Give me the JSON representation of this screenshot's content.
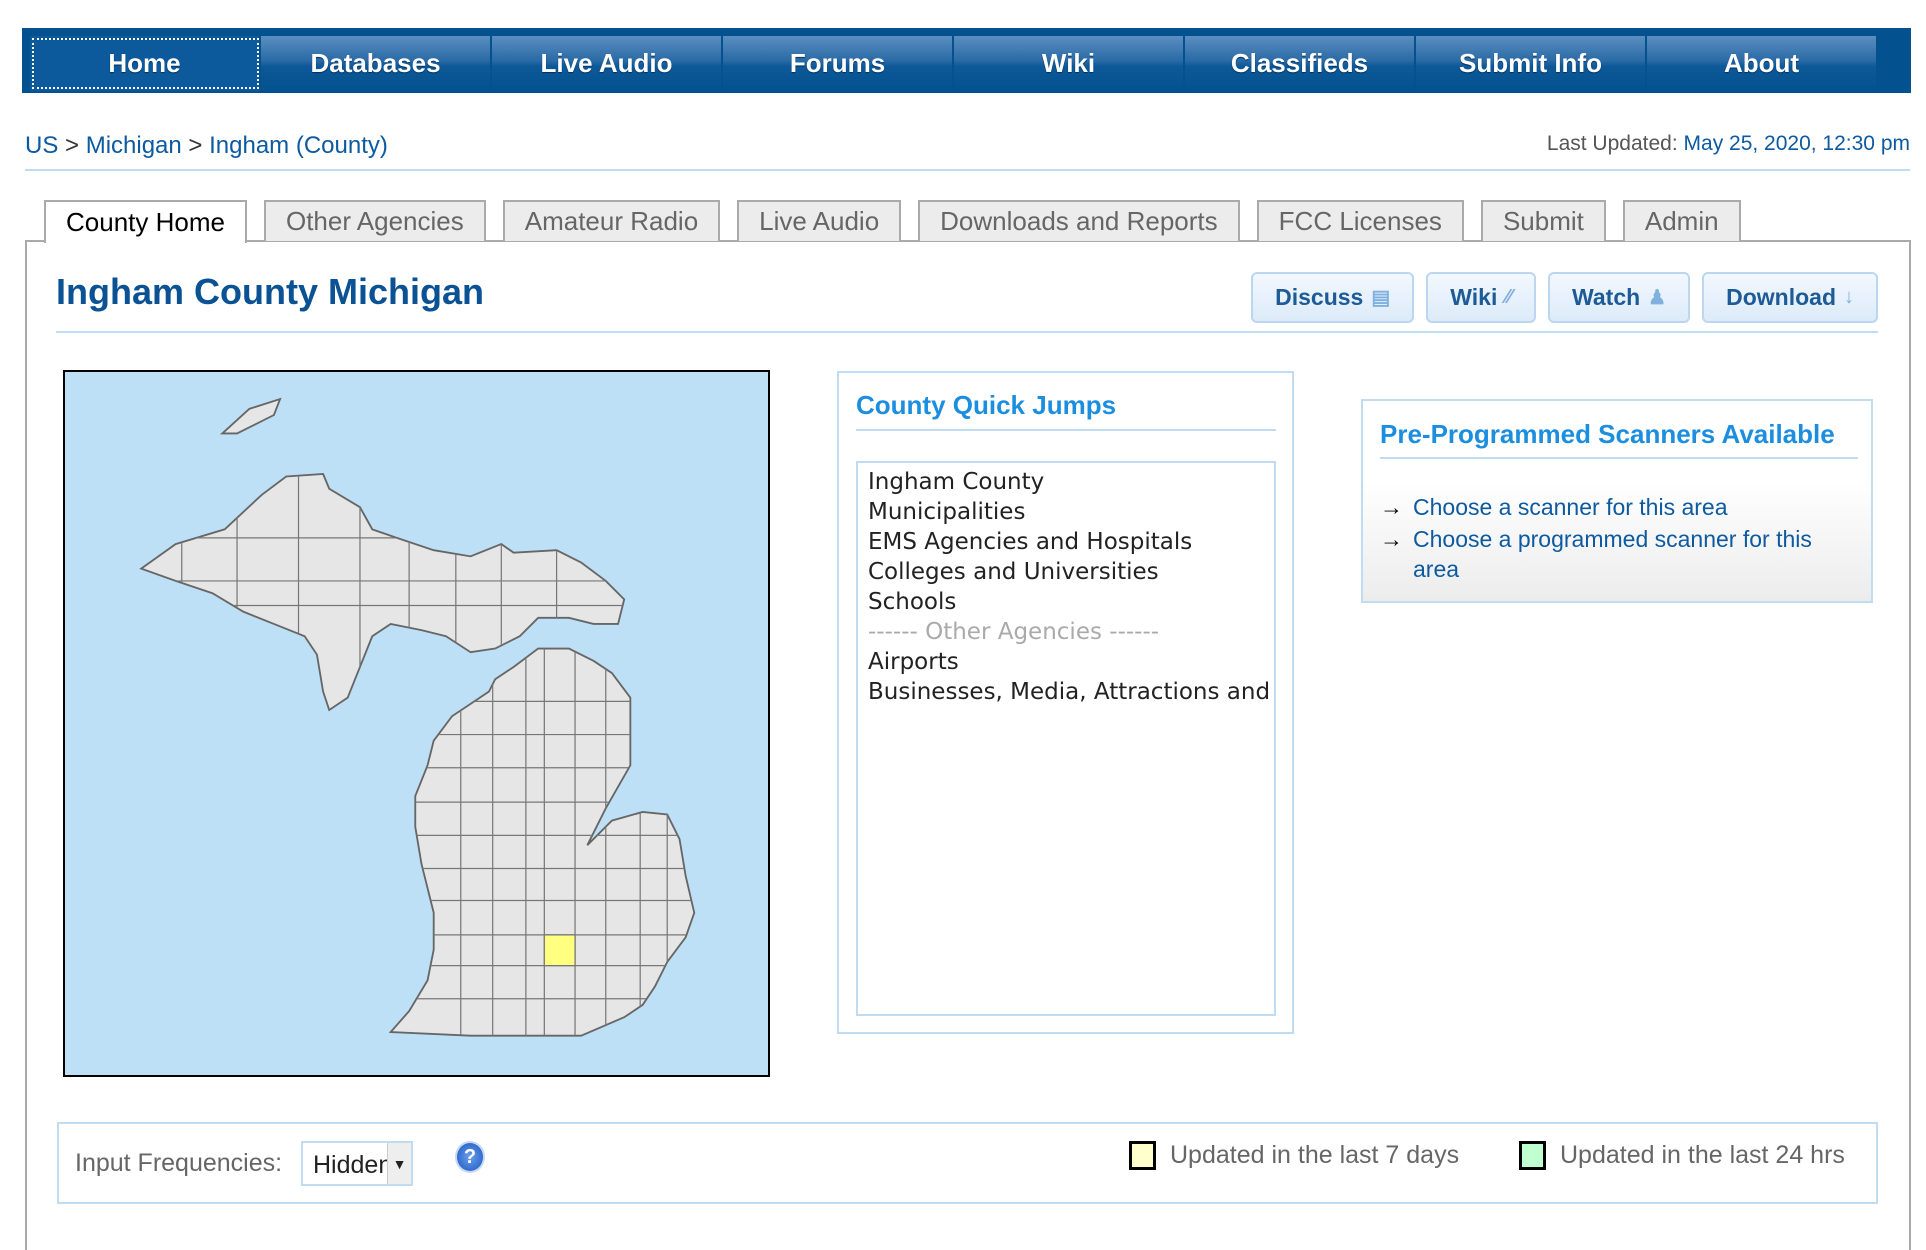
{
  "nav": [
    "Home",
    "Databases",
    "Live Audio",
    "Forums",
    "Wiki",
    "Classifieds",
    "Submit Info",
    "About"
  ],
  "breadcrumb": [
    "US",
    "Michigan",
    "Ingham (County)"
  ],
  "breadcrumb_sep": ">",
  "last_updated": {
    "label": "Last Updated:",
    "value": "May 25, 2020, 12:30 pm"
  },
  "tabs": [
    "County Home",
    "Other Agencies",
    "Amateur Radio",
    "Live Audio",
    "Downloads and Reports",
    "FCC Licenses",
    "Submit",
    "Admin"
  ],
  "page_title": "Ingham County Michigan",
  "actions": [
    {
      "label": "Discuss",
      "icon": "comment-icon"
    },
    {
      "label": "Wiki",
      "icon": "pencil-icon"
    },
    {
      "label": "Watch",
      "icon": "user-icon"
    },
    {
      "label": "Download",
      "icon": "arrow-down-icon"
    }
  ],
  "quick_jumps": {
    "title": "County Quick Jumps",
    "items": [
      "Ingham County",
      "Municipalities",
      "EMS Agencies and Hospitals",
      "Colleges and Universities",
      "Schools",
      "------ Other Agencies ------",
      "Airports",
      "Businesses, Media, Attractions and Events"
    ]
  },
  "preprogrammed": {
    "title": "Pre-Programmed Scanners Available",
    "arrow": "→",
    "links": [
      "Choose a scanner for this area",
      "Choose a programmed scanner for this area"
    ]
  },
  "input_frequencies": {
    "label": "Input Frequencies:",
    "value": "Hidden",
    "help": "?"
  },
  "legend": [
    {
      "label": "Updated in the last 7 days",
      "color": "#ffffcc"
    },
    {
      "label": "Updated in the last 24 hrs",
      "color": "#c0ffd0"
    }
  ],
  "colors": {
    "nav": "#03528f",
    "highlight_county": "#ffff80",
    "water": "#bde0f7"
  }
}
